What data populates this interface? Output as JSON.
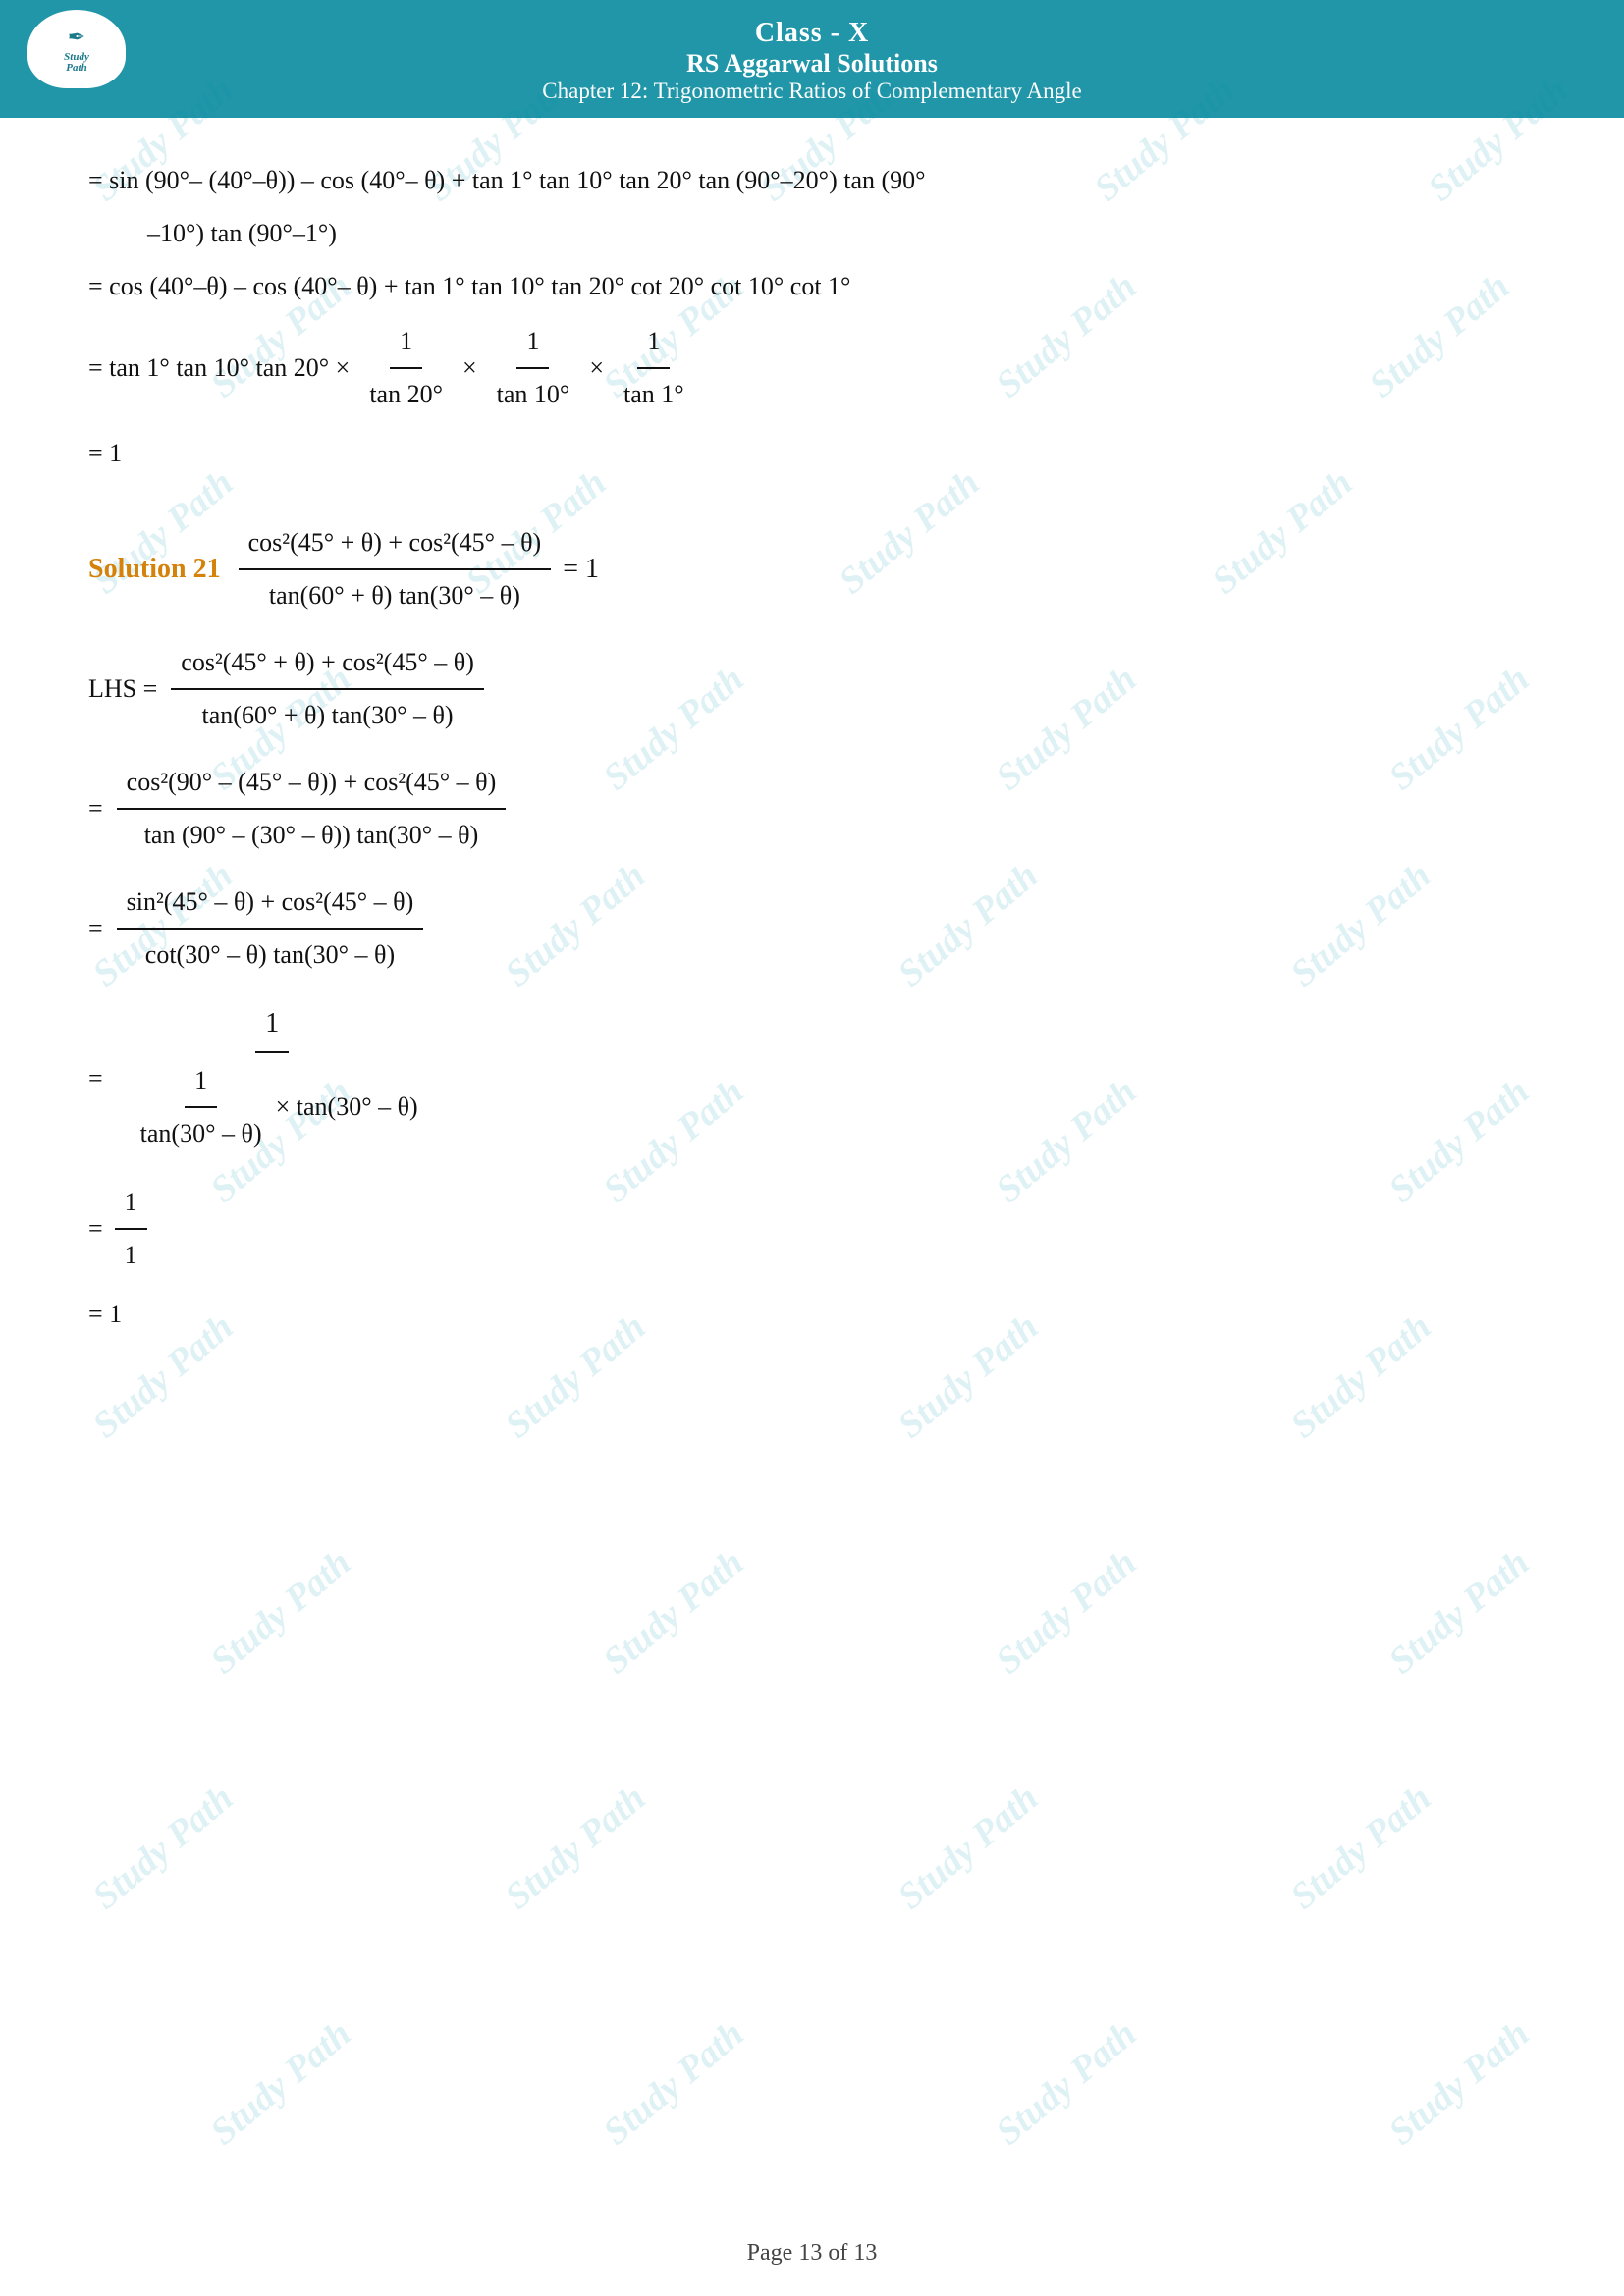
{
  "header": {
    "class_label": "Class - X",
    "rs_label": "RS Aggarwal Solutions",
    "chapter_label": "Chapter 12: Trigonometric Ratios of Complementary Angle"
  },
  "watermarks": [
    "Study Path",
    "Study Path",
    "Study Path"
  ],
  "content": {
    "line1": "= sin (90°– (40°–θ)) – cos (40°– θ) + tan 1° tan 10° tan 20° tan (90°–20°) tan (90°",
    "line2": "–10°) tan (90°–1°)",
    "line3": "= cos (40°–θ) – cos (40°– θ) + tan 1° tan 10° tan 20° cot 20° cot 10° cot 1°",
    "line4_prefix": "=  tan 1° tan 10° tan 20° ×",
    "line4_frac1_num": "1",
    "line4_frac1_den": "tan 20°",
    "line4_cross1": "×",
    "line4_frac2_num": "1",
    "line4_frac2_den": "tan 10°",
    "line4_cross2": "×",
    "line4_frac3_num": "1",
    "line4_frac3_den": "tan 1°",
    "line5": "= 1",
    "solution21_label": "Solution 21",
    "solution21_expr_num": "cos²(45° + θ) + cos²(45° – θ)",
    "solution21_expr_den": "tan(60° + θ) tan(30° – θ)",
    "solution21_eq": "= 1",
    "lhs_label": "LHS =",
    "lhs_frac_num": "cos²(45° + θ) + cos²(45° – θ)",
    "lhs_frac_den": "tan(60° + θ) tan(30° – θ)",
    "step2_prefix": "=",
    "step2_num": "cos²(90° – (45° – θ)) + cos²(45° – θ)",
    "step2_den": "tan (90° – (30° – θ)) tan(30° – θ)",
    "step3_prefix": "=",
    "step3_num": "sin²(45° – θ) + cos²(45° – θ)",
    "step3_den": "cot(30° – θ) tan(30° – θ)",
    "step4_prefix": "=",
    "step4_num": "1",
    "step4_den_num": "1",
    "step4_den_den": "tan(30° – θ)",
    "step4_den_suffix": "× tan(30° – θ)",
    "step5": "= 1/1",
    "step5_num": "1",
    "step5_den": "1",
    "step6": "= 1"
  },
  "footer": {
    "page_label": "Page 13 of 13"
  },
  "logo": {
    "study": "Study",
    "path": "Path"
  }
}
